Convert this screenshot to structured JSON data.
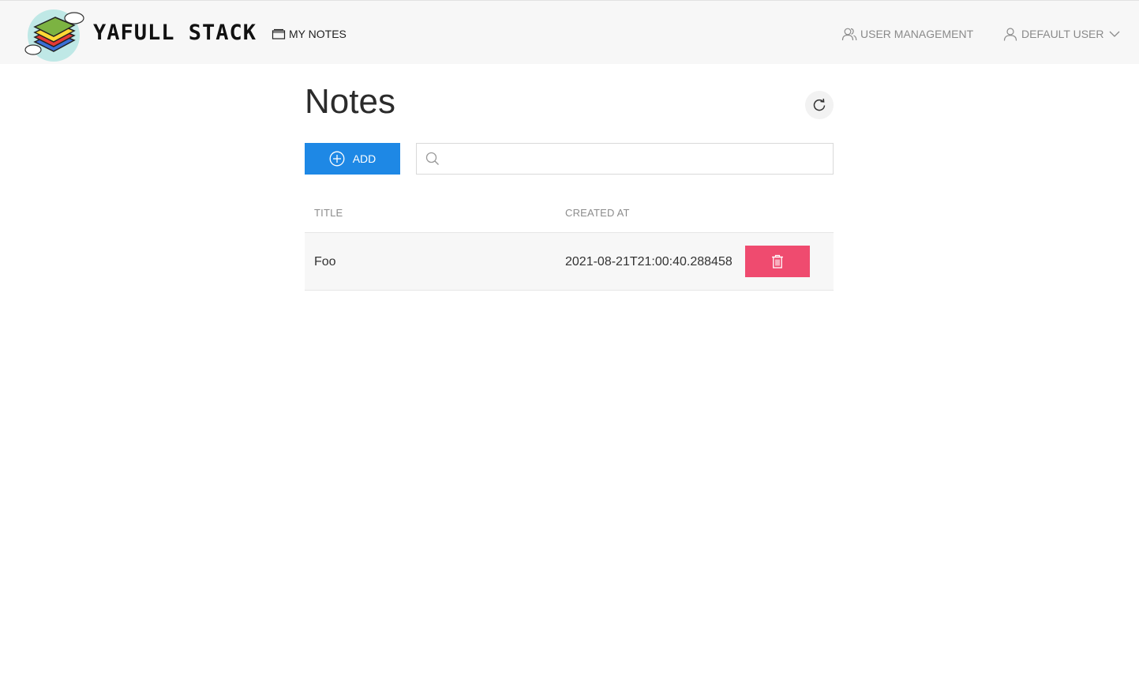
{
  "header": {
    "brand": "YAFULL STACK",
    "nav": {
      "my_notes": "MY NOTES",
      "user_management": "USER MANAGEMENT",
      "user_menu": "DEFAULT USER"
    }
  },
  "page": {
    "title": "Notes"
  },
  "toolbar": {
    "add_label": "ADD",
    "search_value": "",
    "search_placeholder": ""
  },
  "table": {
    "columns": [
      "TITLE",
      "CREATED AT"
    ],
    "rows": [
      {
        "title": "Foo",
        "created_at": "2021-08-21T21:00:40.288458"
      }
    ]
  },
  "colors": {
    "primary": "#1e88e5",
    "danger": "#ef4b6f",
    "header_bg": "#f7f7f7"
  },
  "icons": {
    "logo": "stacked-layers-logo",
    "notes": "folder-icon",
    "users": "users-icon",
    "user": "user-icon",
    "refresh": "refresh-icon",
    "add": "plus-circle-icon",
    "search": "search-icon",
    "delete": "trash-icon"
  }
}
